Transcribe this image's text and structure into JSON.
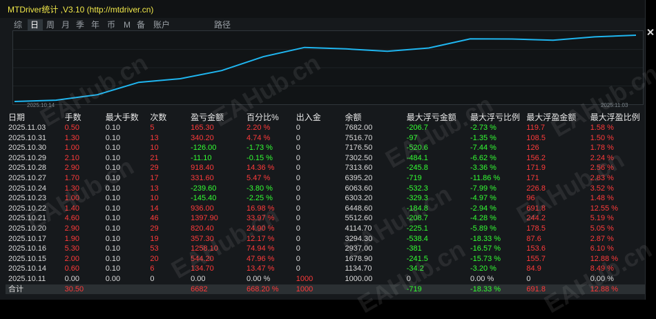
{
  "window": {
    "title": "MTDriver统计 ,V3.10 (http://mtdriver.cn)"
  },
  "tabs": [
    "综",
    "日",
    "周",
    "月",
    "季",
    "年",
    "币",
    "M",
    "备",
    "账户",
    "路径"
  ],
  "active_tab": "日",
  "chart": {
    "x_start": "2025.10.14",
    "x_end": "2025.11.03",
    "line_color": "#1fb6f0",
    "dates": [
      "2025.10.14",
      "2025.10.15",
      "2025.10.16",
      "2025.10.17",
      "2025.10.20",
      "2025.10.21",
      "2025.10.22",
      "2025.10.23",
      "2025.10.24",
      "2025.10.27",
      "2025.10.28",
      "2025.10.29",
      "2025.10.30",
      "2025.10.31",
      "2025.11.03"
    ],
    "values": [
      134.7,
      679.4,
      1937.5,
      2294.8,
      3115.2,
      4513.1,
      5449.1,
      5303.7,
      5064.1,
      5395.7,
      6314.1,
      6303.0,
      6177.0,
      6517.2,
      6682.5
    ]
  },
  "watermark": "EAHub.cn",
  "table": {
    "headers": [
      "日期",
      "手数",
      "最大手数",
      "次数",
      "盈亏金额",
      "百分比%",
      "出入金",
      "余额",
      "最大浮亏金额",
      "最大浮亏比例",
      "最大浮盈金额",
      "最大浮盈比例"
    ],
    "rows": [
      [
        "2025.11.03",
        "0.50",
        "0.10",
        "5",
        "165.30",
        "2.20 %",
        "0",
        "7682.00",
        "-206.7",
        "-2.73 %",
        "119.7",
        "1.58 %"
      ],
      [
        "2025.10.31",
        "1.30",
        "0.10",
        "13",
        "340.20",
        "4.74 %",
        "0",
        "7516.70",
        "-97",
        "-1.35 %",
        "108.5",
        "1.50 %"
      ],
      [
        "2025.10.30",
        "1.00",
        "0.10",
        "10",
        "-126.00",
        "-1.73 %",
        "0",
        "7176.50",
        "-520.6",
        "-7.44 %",
        "126",
        "1.78 %"
      ],
      [
        "2025.10.29",
        "2.10",
        "0.10",
        "21",
        "-11.10",
        "-0.15 %",
        "0",
        "7302.50",
        "-484.1",
        "-6.62 %",
        "156.2",
        "2.24 %"
      ],
      [
        "2025.10.28",
        "2.90",
        "0.10",
        "29",
        "918.40",
        "14.36 %",
        "0",
        "7313.60",
        "-245.8",
        "-3.36 %",
        "171.9",
        "2.56 %"
      ],
      [
        "2025.10.27",
        "1.70",
        "0.10",
        "17",
        "331.60",
        "5.47 %",
        "0",
        "6395.20",
        "-719",
        "-11.86 %",
        "171",
        "2.83 %"
      ],
      [
        "2025.10.24",
        "1.30",
        "0.10",
        "13",
        "-239.60",
        "-3.80 %",
        "0",
        "6063.60",
        "-532.3",
        "-7.99 %",
        "226.8",
        "3.52 %"
      ],
      [
        "2025.10.23",
        "1.00",
        "0.10",
        "10",
        "-145.40",
        "-2.25 %",
        "0",
        "6303.20",
        "-329.3",
        "-4.97 %",
        "96",
        "1.48 %"
      ],
      [
        "2025.10.22",
        "1.40",
        "0.10",
        "14",
        "936.00",
        "16.98 %",
        "0",
        "6448.60",
        "-184.8",
        "-2.94 %",
        "691.8",
        "12.55 %"
      ],
      [
        "2025.10.21",
        "4.60",
        "0.10",
        "46",
        "1397.90",
        "33.97 %",
        "0",
        "5512.60",
        "-208.7",
        "-4.28 %",
        "244.2",
        "5.19 %"
      ],
      [
        "2025.10.20",
        "2.90",
        "0.10",
        "29",
        "820.40",
        "24.90 %",
        "0",
        "4114.70",
        "-225.1",
        "-5.89 %",
        "178.5",
        "5.05 %"
      ],
      [
        "2025.10.17",
        "1.90",
        "0.10",
        "19",
        "357.30",
        "12.17 %",
        "0",
        "3294.30",
        "-538.4",
        "-18.33 %",
        "87.6",
        "2.87 %"
      ],
      [
        "2025.10.16",
        "5.30",
        "0.10",
        "53",
        "1258.10",
        "74.94 %",
        "0",
        "2937.00",
        "-381",
        "-16.57 %",
        "153.6",
        "6.10 %"
      ],
      [
        "2025.10.15",
        "2.00",
        "0.10",
        "20",
        "544.20",
        "47.96 %",
        "0",
        "1678.90",
        "-241.5",
        "-15.73 %",
        "155.7",
        "12.88 %"
      ],
      [
        "2025.10.14",
        "0.60",
        "0.10",
        "6",
        "134.70",
        "13.47 %",
        "0",
        "1134.70",
        "-34.2",
        "-3.20 %",
        "84.9",
        "8.49 %"
      ],
      [
        "2025.10.11",
        "0.00",
        "0.00",
        "0",
        "0.00",
        "0.00 %",
        "1000",
        "1000.00",
        "0",
        "0.00 %",
        "0",
        "0.00 %"
      ]
    ],
    "total": [
      "合计",
      "30.50",
      "",
      "",
      "6682",
      "668.20 %",
      "1000",
      "",
      "-719",
      "-18.33 %",
      "691.8",
      "12.88 %"
    ]
  }
}
